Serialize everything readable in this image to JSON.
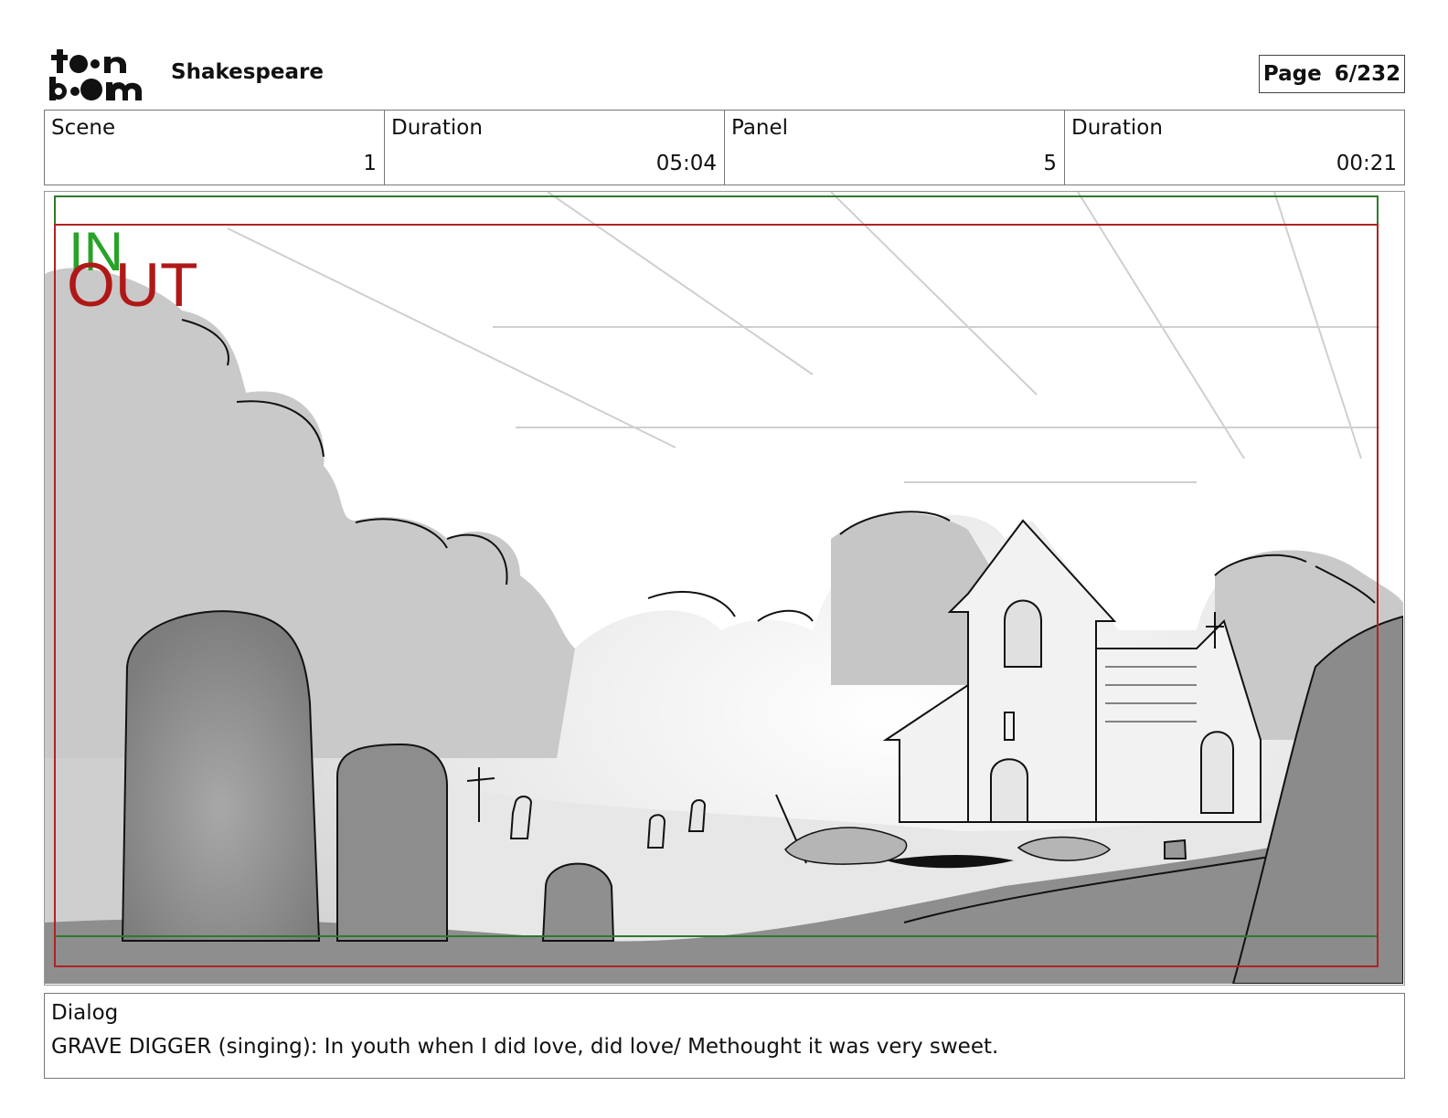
{
  "header": {
    "logo_text": "toon boom",
    "project_title": "Shakespeare",
    "page_label": "Page",
    "page_value": "6/232"
  },
  "info": {
    "scene_label": "Scene",
    "scene_value": "1",
    "duration_label": "Duration",
    "duration_value": "05:04",
    "panel_label": "Panel",
    "panel_value": "5",
    "panel_duration_label": "Duration",
    "panel_duration_value": "00:21"
  },
  "panel": {
    "in_marker": "IN",
    "out_marker": "OUT",
    "colors": {
      "in": "#27a327",
      "out": "#b01818",
      "safe_frame_green": "#2d7a2d",
      "safe_frame_red": "#b22222"
    }
  },
  "dialog": {
    "label": "Dialog",
    "text": "GRAVE DIGGER (singing): In youth when I did love, did love/ Methought it was very sweet."
  }
}
